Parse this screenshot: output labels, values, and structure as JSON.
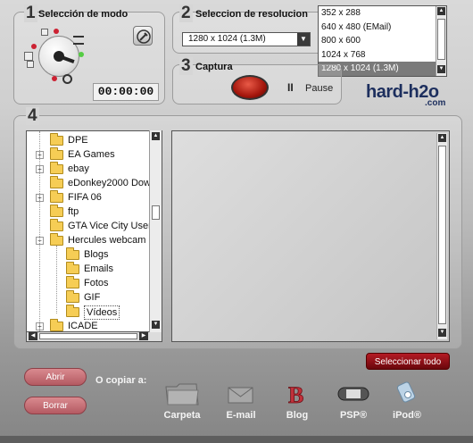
{
  "sections": {
    "mode": {
      "number": "1",
      "title": "Selección de modo",
      "timer": "00:00:00"
    },
    "resolution": {
      "number": "2",
      "title": "Seleccion de resolucion",
      "selected": "1280 x 1024 (1.3M)",
      "options": [
        "352 x 288",
        "640 x 480 (EMail)",
        "800 x 600",
        "1024 x 768",
        "1280 x 1024 (1.3M)"
      ],
      "highlighted_index": 4
    },
    "capture": {
      "number": "3",
      "title": "Captura",
      "pause_label": "Pause",
      "pause_icon": "II"
    },
    "browser": {
      "number": "4"
    }
  },
  "brand": {
    "name": "hard-h2o",
    "suffix": ".com",
    "color": "#1d2f5e"
  },
  "tree": {
    "items": [
      {
        "label": "DPE",
        "expander": "",
        "level": 0
      },
      {
        "label": "EA Games",
        "expander": "+",
        "level": 0
      },
      {
        "label": "ebay",
        "expander": "+",
        "level": 0
      },
      {
        "label": "eDonkey2000 Dow",
        "expander": "",
        "level": 0
      },
      {
        "label": "FIFA 06",
        "expander": "+",
        "level": 0
      },
      {
        "label": "ftp",
        "expander": "",
        "level": 0
      },
      {
        "label": "GTA Vice City User",
        "expander": "",
        "level": 0
      },
      {
        "label": "Hercules webcam",
        "expander": "−",
        "level": 0
      },
      {
        "label": "Blogs",
        "expander": "",
        "level": 1
      },
      {
        "label": "Emails",
        "expander": "",
        "level": 1
      },
      {
        "label": "Fotos",
        "expander": "",
        "level": 1
      },
      {
        "label": "GIF",
        "expander": "",
        "level": 1
      },
      {
        "label": "Vídeos",
        "expander": "",
        "level": 1
      },
      {
        "label": "ICADE",
        "expander": "+",
        "level": 0
      }
    ]
  },
  "buttons": {
    "open": "Abrir",
    "delete": "Borrar",
    "select_all": "Seleccionar todo"
  },
  "copy": {
    "label": "O copiar a:",
    "destinations": [
      {
        "label": "Carpeta",
        "icon": "folder-icon"
      },
      {
        "label": "E-mail",
        "icon": "envelope-icon"
      },
      {
        "label": "Blog",
        "icon": "blog-icon"
      },
      {
        "label": "PSP®",
        "icon": "psp-icon"
      },
      {
        "label": "iPod®",
        "icon": "ipod-icon"
      }
    ]
  }
}
